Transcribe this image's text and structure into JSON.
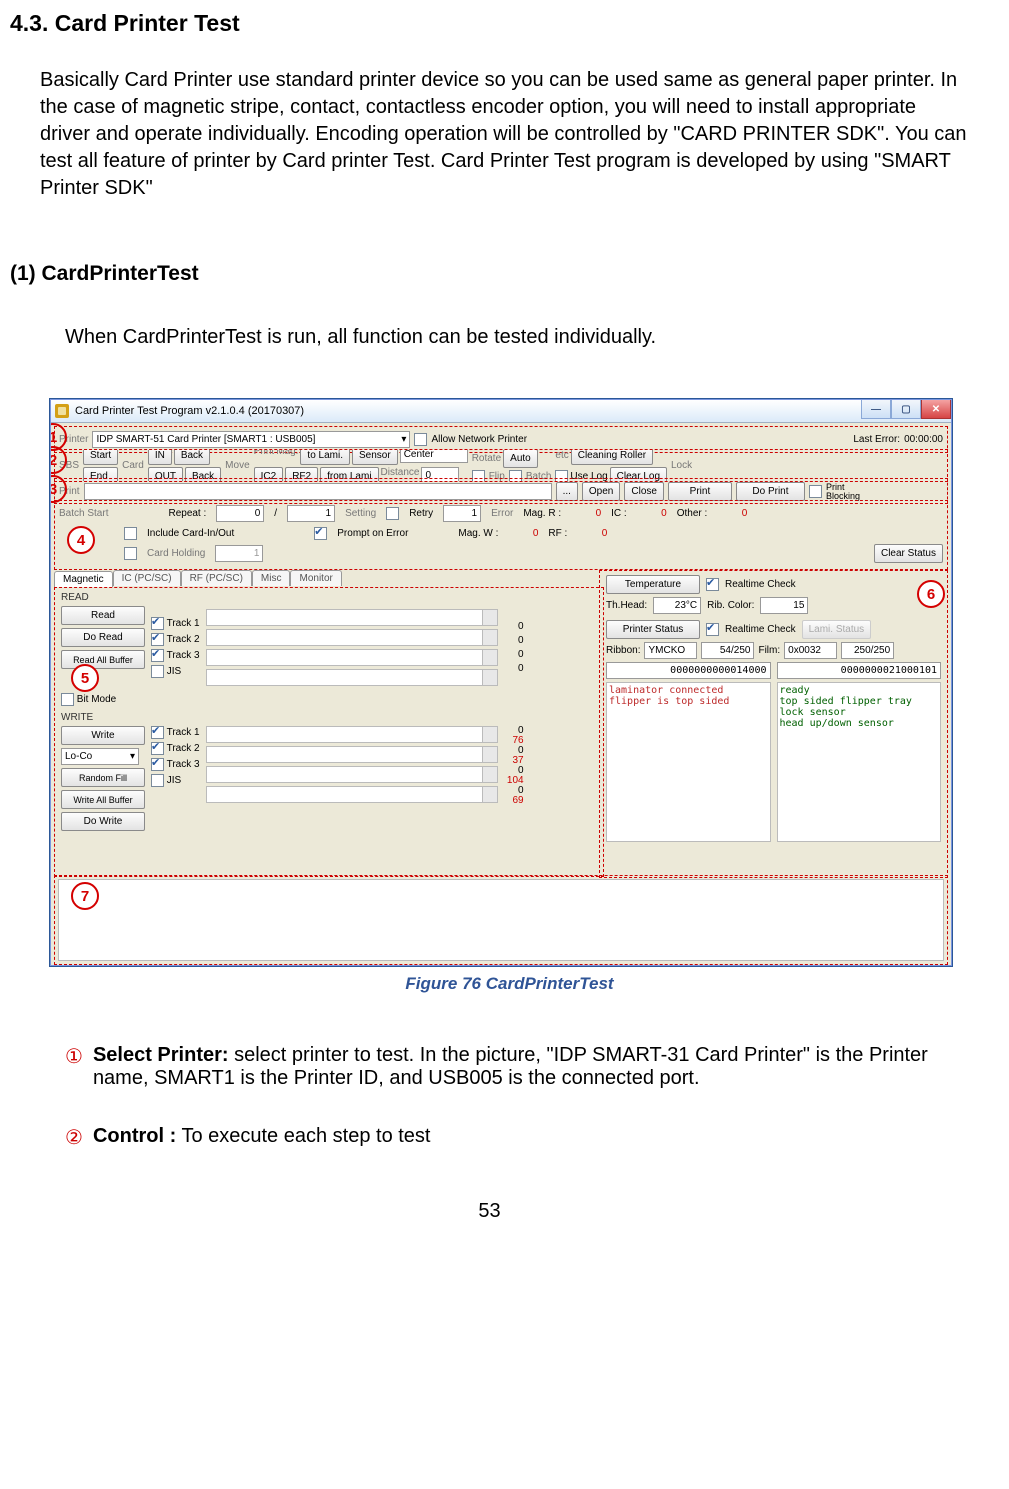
{
  "heading": "4.3. Card Printer Test",
  "intro": "Basically Card Printer use standard printer device so you can be used same as general paper printer. In the case of magnetic stripe, contact, contactless encoder option, you will need to install appropriate driver and operate individually. Encoding operation will be controlled by \"CARD PRINTER SDK\". You can test all feature of printer by Card printer Test. Card Printer Test program is developed by using \"SMART Printer SDK\"",
  "subheading": "(1) CardPrinterTest",
  "subdesc": "When CardPrinterTest is run, all function can be tested individually.",
  "fig_caption": "Figure 76 CardPrinterTest",
  "list": {
    "i1_num": "①",
    "i1_bold": "Select Printer:",
    "i1_txt": " select printer to test. In the picture, \"IDP SMART-31 Card Printer\" is the Printer name, SMART1 is the Printer ID, and USB005 is the connected port.",
    "i2_num": "②",
    "i2_bold": "Control :",
    "i2_txt": " To execute each step to test"
  },
  "page_number": "53",
  "app": {
    "title": "Card Printer Test Program v2.1.0.4 (20170307)",
    "row1": {
      "printer_lbl": "Printer",
      "printer_val": "IDP SMART-51 Card Printer  [SMART1 : USB005]",
      "allow_net": "Allow Network Printer",
      "last_error_lbl": "Last Error:",
      "last_error_val": "00:00:00"
    },
    "row2": {
      "sbs_lbl": "SBS",
      "start": "Start",
      "end": "End",
      "card_lbl": "Card",
      "in": "IN",
      "out": "OUT",
      "back": "Back",
      "move_lbl": "Move",
      "print_lbl": "Print",
      "mag_lbl": "Mag.",
      "tolami": "to Lami.",
      "ic2": "IC2",
      "rf2": "RF2",
      "fromlami": "from Lami",
      "sensor": "Sensor",
      "center": "Center",
      "distance_lbl": "Distance",
      "distance_val": "0",
      "rotate_lbl": "Rotate",
      "auto": "Auto",
      "flip": "Flip",
      "batch": "Batch",
      "etc_lbl": "etc",
      "cleaning": "Cleaning Roller",
      "uselog": "Use Log",
      "clearlog": "Clear Log",
      "lock_lbl": "Lock"
    },
    "row3": {
      "print_lbl": "Print",
      "dots": "...",
      "open": "Open",
      "close": "Close",
      "print": "Print",
      "doprint": "Do Print",
      "printblocking": "Print\nBlocking"
    },
    "batch": {
      "batchstart_lbl": "Batch Start",
      "repeat_lbl": "Repeat :",
      "repeat_a": "0",
      "repeat_b": "/",
      "repeat_c": "1",
      "setting_lbl": "Setting",
      "retry": "Retry",
      "retry_val": "1",
      "error_lbl": "Error",
      "magr": "Mag. R :",
      "magr_v": "0",
      "ic": "IC :",
      "ic_v": "0",
      "other": "Other :",
      "other_v": "0",
      "include": "Include Card-In/Out",
      "prompt": "Prompt on Error",
      "magw": "Mag. W :",
      "magw_v": "0",
      "rf": "RF :",
      "rf_v": "0",
      "cardholding": "Card Holding",
      "cardholding_v": "1",
      "clearstatus": "Clear Status"
    },
    "tabs": {
      "magnetic": "Magnetic",
      "icpcsc": "IC (PC/SC)",
      "rfpcsc": "RF (PC/SC)",
      "misc": "Misc",
      "monitor": "Monitor"
    },
    "mag": {
      "read_h": "READ",
      "read": "Read",
      "doread": "Do Read",
      "readall": "Read All Buffer",
      "t1": "Track 1",
      "t2": "Track 2",
      "t3": "Track 3",
      "jis": "JIS",
      "bitmode": "Bit Mode",
      "write_h": "WRITE",
      "write": "Write",
      "loco": "Lo-Co",
      "random": "Random Fill",
      "writeall": "Write All Buffer",
      "dowrite": "Do Write",
      "r_t1": "0",
      "r_t2": "0",
      "r_t3": "0",
      "r_jis": "0",
      "w_t1a": "0",
      "w_t1b": "76",
      "w_t2a": "0",
      "w_t2b": "37",
      "w_t3a": "0",
      "w_t3b": "104",
      "w_jisa": "0",
      "w_jisb": "69"
    },
    "stat": {
      "temp_btn": "Temperature",
      "realtime": "Realtime Check",
      "thhead_lbl": "Th.Head:",
      "thhead_val": "23°C",
      "ribcolor_lbl": "Rib. Color:",
      "ribcolor_val": "15",
      "ps_btn": "Printer Status",
      "lamstatus": "Lami. Status",
      "ribbon_lbl": "Ribbon:",
      "ribbon_type": "YMCKO",
      "ribbon_cnt": "54/250",
      "film_lbl": "Film:",
      "film_type": "0x0032",
      "film_cnt": "250/250",
      "code_l": "0000000000014000",
      "code_r": "0000000021000101",
      "msg_l": "laminator connected\nflipper is top sided",
      "msg_r": "ready\ntop sided flipper tray\nlock sensor\nhead up/down sensor"
    }
  },
  "annot": {
    "c1": "1",
    "c2": "2",
    "c3": "3",
    "c4": "4",
    "c5": "5",
    "c6": "6",
    "c7": "7"
  }
}
